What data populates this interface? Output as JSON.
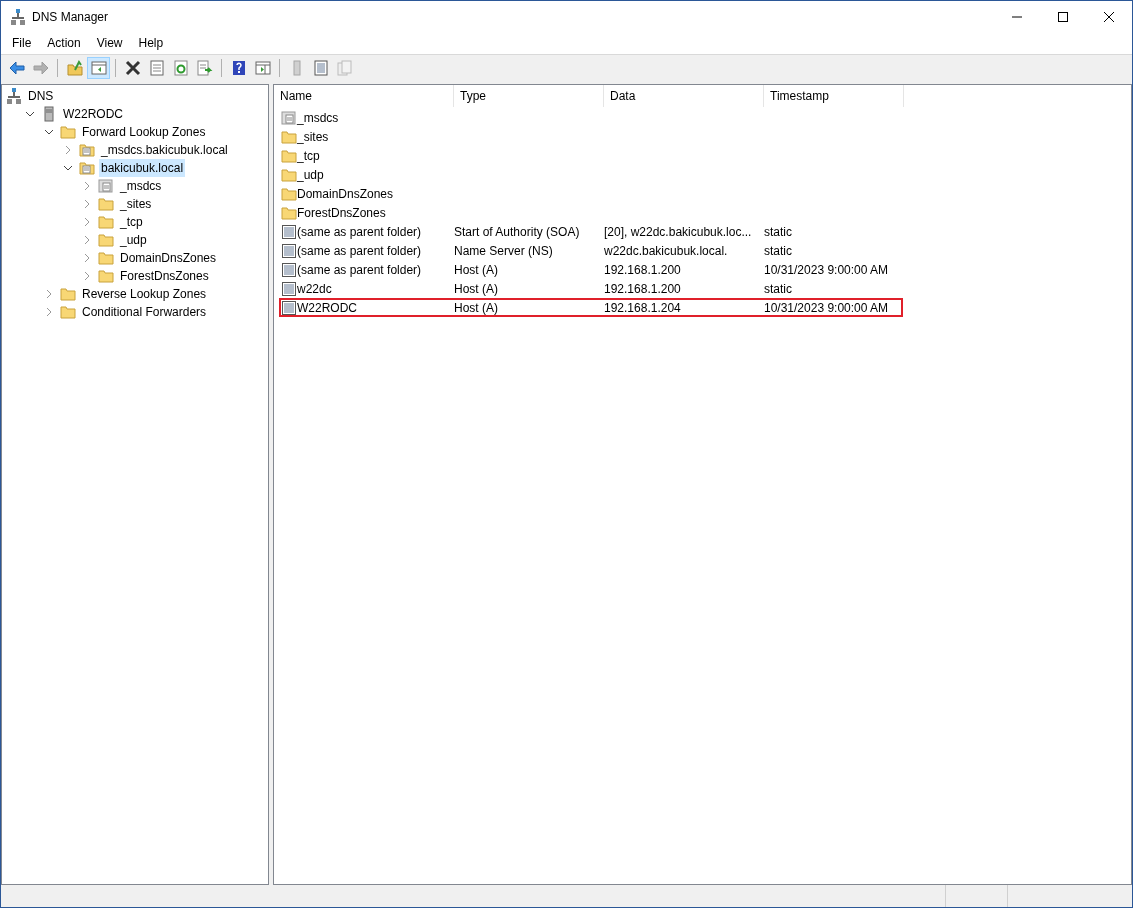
{
  "window": {
    "title": "DNS Manager"
  },
  "menu": [
    "File",
    "Action",
    "View",
    "Help"
  ],
  "toolbar": [
    {
      "kind": "back",
      "disabled": false
    },
    {
      "kind": "forward",
      "disabled": true
    },
    {
      "kind": "sep"
    },
    {
      "kind": "up",
      "disabled": false
    },
    {
      "kind": "pane",
      "disabled": false,
      "selected": true
    },
    {
      "kind": "sep"
    },
    {
      "kind": "delete",
      "disabled": false
    },
    {
      "kind": "properties",
      "disabled": false
    },
    {
      "kind": "refresh",
      "disabled": false
    },
    {
      "kind": "export",
      "disabled": false
    },
    {
      "kind": "sep"
    },
    {
      "kind": "help",
      "disabled": false
    },
    {
      "kind": "action-pane",
      "disabled": false
    },
    {
      "kind": "sep"
    },
    {
      "kind": "server",
      "disabled": true
    },
    {
      "kind": "record",
      "disabled": false
    },
    {
      "kind": "copy",
      "disabled": true
    }
  ],
  "tree": [
    {
      "label": "DNS",
      "kind": "dns",
      "selected": false,
      "children": [
        {
          "label": "W22RODC",
          "kind": "server",
          "selected": false,
          "expanded": true,
          "children": [
            {
              "label": "Forward Lookup Zones",
              "kind": "folder",
              "selected": false,
              "expanded": true,
              "children": [
                {
                  "label": "_msdcs.bakicubuk.local",
                  "kind": "zone",
                  "selected": false,
                  "expanded": false
                },
                {
                  "label": "bakicubuk.local",
                  "kind": "zone",
                  "selected": true,
                  "expanded": true,
                  "children": [
                    {
                      "label": "_msdcs",
                      "kind": "delegation",
                      "selected": false,
                      "expanded": false
                    },
                    {
                      "label": "_sites",
                      "kind": "folder",
                      "selected": false,
                      "expanded": false
                    },
                    {
                      "label": "_tcp",
                      "kind": "folder",
                      "selected": false,
                      "expanded": false
                    },
                    {
                      "label": "_udp",
                      "kind": "folder",
                      "selected": false,
                      "expanded": false
                    },
                    {
                      "label": "DomainDnsZones",
                      "kind": "folder",
                      "selected": false,
                      "expanded": false
                    },
                    {
                      "label": "ForestDnsZones",
                      "kind": "folder",
                      "selected": false,
                      "expanded": false
                    }
                  ]
                }
              ]
            },
            {
              "label": "Reverse Lookup Zones",
              "kind": "folder",
              "selected": false,
              "expanded": false
            },
            {
              "label": "Conditional Forwarders",
              "kind": "folder",
              "selected": false,
              "expanded": false
            }
          ]
        }
      ]
    }
  ],
  "table": {
    "columns": [
      "Name",
      "Type",
      "Data",
      "Timestamp"
    ],
    "rows": [
      {
        "kind": "delegation",
        "highlighted": false,
        "cells": [
          "_msdcs",
          "",
          "",
          ""
        ]
      },
      {
        "kind": "folder",
        "highlighted": false,
        "cells": [
          "_sites",
          "",
          "",
          ""
        ]
      },
      {
        "kind": "folder",
        "highlighted": false,
        "cells": [
          "_tcp",
          "",
          "",
          ""
        ]
      },
      {
        "kind": "folder",
        "highlighted": false,
        "cells": [
          "_udp",
          "",
          "",
          ""
        ]
      },
      {
        "kind": "folder",
        "highlighted": false,
        "cells": [
          "DomainDnsZones",
          "",
          "",
          ""
        ]
      },
      {
        "kind": "folder",
        "highlighted": false,
        "cells": [
          "ForestDnsZones",
          "",
          "",
          ""
        ]
      },
      {
        "kind": "record",
        "highlighted": false,
        "cells": [
          "(same as parent folder)",
          "Start of Authority (SOA)",
          "[20], w22dc.bakicubuk.loc...",
          "static"
        ]
      },
      {
        "kind": "record",
        "highlighted": false,
        "cells": [
          "(same as parent folder)",
          "Name Server (NS)",
          "w22dc.bakicubuk.local.",
          "static"
        ]
      },
      {
        "kind": "record",
        "highlighted": false,
        "cells": [
          "(same as parent folder)",
          "Host (A)",
          "192.168.1.200",
          "10/31/2023 9:00:00 AM"
        ]
      },
      {
        "kind": "record",
        "highlighted": false,
        "cells": [
          "w22dc",
          "Host (A)",
          "192.168.1.200",
          "static"
        ]
      },
      {
        "kind": "record",
        "highlighted": true,
        "cells": [
          "W22RODC",
          "Host (A)",
          "192.168.1.204",
          "10/31/2023 9:00:00 AM"
        ]
      }
    ]
  }
}
